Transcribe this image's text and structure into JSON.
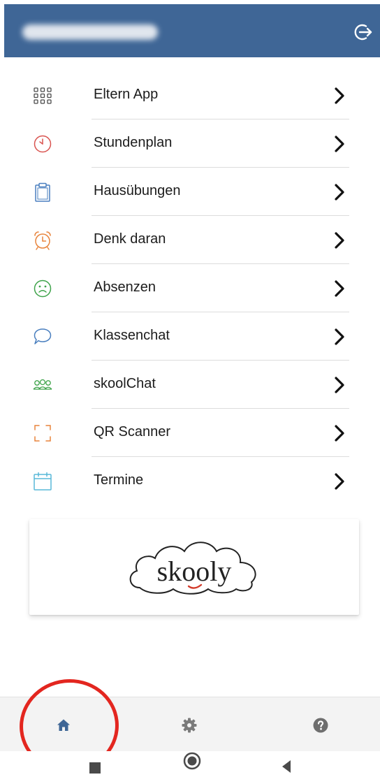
{
  "header": {
    "user_name": "",
    "logout_icon": "logout-icon",
    "background": "#3f6696"
  },
  "menu": {
    "items": [
      {
        "label": "Eltern App",
        "icon": "apps-grid-icon"
      },
      {
        "label": "Stundenplan",
        "icon": "clock-icon"
      },
      {
        "label": "Hausübungen",
        "icon": "clipboard-icon"
      },
      {
        "label": "Denk daran",
        "icon": "alarm-clock-icon"
      },
      {
        "label": "Absenzen",
        "icon": "sad-face-icon"
      },
      {
        "label": "Klassenchat",
        "icon": "chat-bubbles-icon"
      },
      {
        "label": "skoolChat",
        "icon": "people-icon"
      },
      {
        "label": "QR Scanner",
        "icon": "scanner-frame-icon"
      },
      {
        "label": "Termine",
        "icon": "calendar-icon"
      }
    ]
  },
  "logo": {
    "text": "skooly"
  },
  "bottom_nav": {
    "items": [
      {
        "name": "home",
        "icon": "home-icon",
        "active": true
      },
      {
        "name": "settings",
        "icon": "gear-icon",
        "active": false
      },
      {
        "name": "help",
        "icon": "help-icon",
        "active": false
      }
    ]
  },
  "colors": {
    "accent": "#3f6696",
    "highlight": "#e3261f",
    "icon_red": "#d9534f",
    "icon_orange": "#e8843c",
    "icon_green": "#3ea34a",
    "icon_blue": "#4a7fbf",
    "icon_teal": "#58b8d8",
    "icon_gray": "#5a5a5a"
  }
}
